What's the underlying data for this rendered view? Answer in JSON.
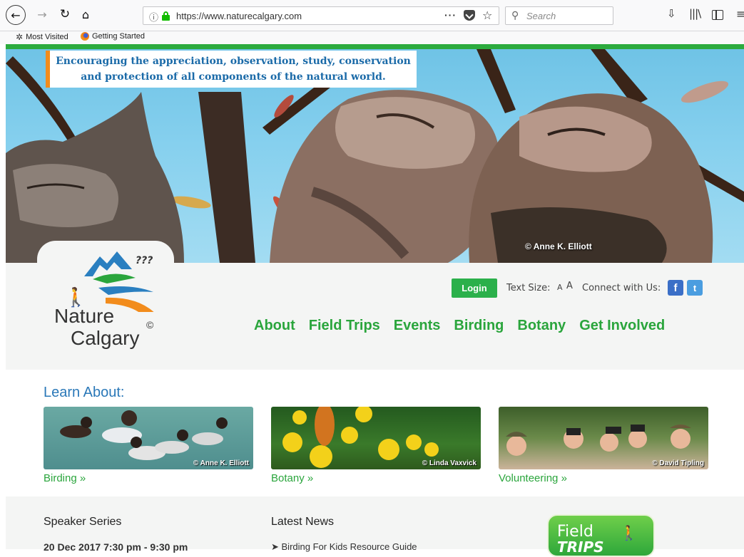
{
  "browser": {
    "url": "https://www.naturecalgary.com",
    "search_placeholder": "Search",
    "icons": {
      "back": "←",
      "forward": "→",
      "reload": "↻",
      "home": "⌂",
      "info": "ⓘ",
      "page_actions": "···",
      "bookmark_star": "☆",
      "search": "⚲",
      "downloads": "⇩",
      "library": "|||\\",
      "menu": "≡"
    },
    "bookmarks": [
      {
        "label": "Most Visited",
        "icon": "gear-icon"
      },
      {
        "label": "Getting Started",
        "icon": "firefox-icon"
      }
    ]
  },
  "site": {
    "tagline_line1": "Encouraging the appreciation, observation, study, conservation",
    "tagline_line2": "and protection of all components of the natural world.",
    "hero_credit": "© Anne K. Elliott",
    "logo_line1": "Nature",
    "logo_line2": "Calgary",
    "logo_copyright": "©",
    "login_label": "Login",
    "text_size_label": "Text Size:",
    "text_size_small": "A",
    "text_size_large": "A",
    "connect_label": "Connect with Us:",
    "social": {
      "facebook": "f",
      "twitter": "t"
    },
    "nav": [
      "About",
      "Field Trips",
      "Events",
      "Birding",
      "Botany",
      "Get Involved"
    ],
    "learn_title": "Learn About:",
    "learn_items": [
      {
        "link": "Birding »",
        "credit": "© Anne K. Elliott"
      },
      {
        "link": "Botany »",
        "credit": "© Linda Vaxvick"
      },
      {
        "link": "Volunteering »",
        "credit": "© David Tipling"
      }
    ],
    "speaker_title": "Speaker Series",
    "speaker_date": "20 Dec 2017 7:30 pm - 9:30 pm",
    "news_title": "Latest News",
    "news_items": [
      "➤ Birding For Kids Resource Guide"
    ],
    "field_trips_badge_line1": "Field",
    "field_trips_badge_line2": "TRIPS"
  },
  "colors": {
    "brand_green": "#2aa53c",
    "login_green": "#2bb04b",
    "link_blue": "#2a78b8",
    "accent_orange": "#f28c1c"
  }
}
